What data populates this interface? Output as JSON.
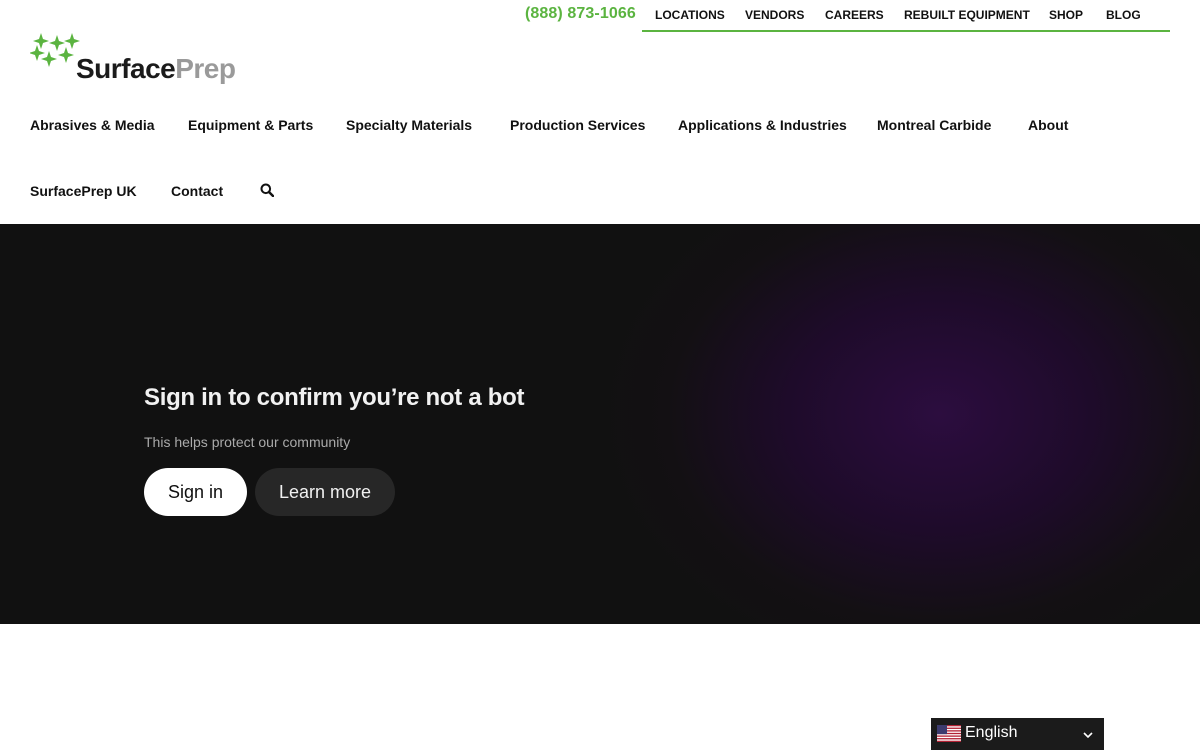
{
  "colors": {
    "brand_green": "#5bb440",
    "phone_green": "#5bb440",
    "nav_text": "#111111",
    "embed_bg": "#111111",
    "embed_glow": "#2c0d3f"
  },
  "header": {
    "phone": "(888) 873-1066",
    "utility_links": [
      "LOCATIONS",
      "VENDORS",
      "CAREERS",
      "REBUILT EQUIPMENT",
      "SHOP",
      "BLOG"
    ],
    "logo": {
      "word1": "Surface",
      "word2": "Prep",
      "icon": "sparkle-cluster-logo-icon"
    },
    "nav_row1": [
      "Abrasives & Media",
      "Equipment & Parts",
      "Specialty Materials",
      "Production Services",
      "Applications & Industries",
      "Montreal Carbide",
      "About"
    ],
    "nav_row2": [
      "SurfacePrep UK",
      "Contact"
    ],
    "search_icon": "search-icon"
  },
  "embed": {
    "title": "Sign in to confirm you’re not a bot",
    "subtitle": "This helps protect our community",
    "signin_label": "Sign in",
    "learn_more_label": "Learn more"
  },
  "language_selector": {
    "label": "English",
    "flag_icon": "us-flag-icon",
    "chevron_icon": "chevron-down-icon"
  }
}
